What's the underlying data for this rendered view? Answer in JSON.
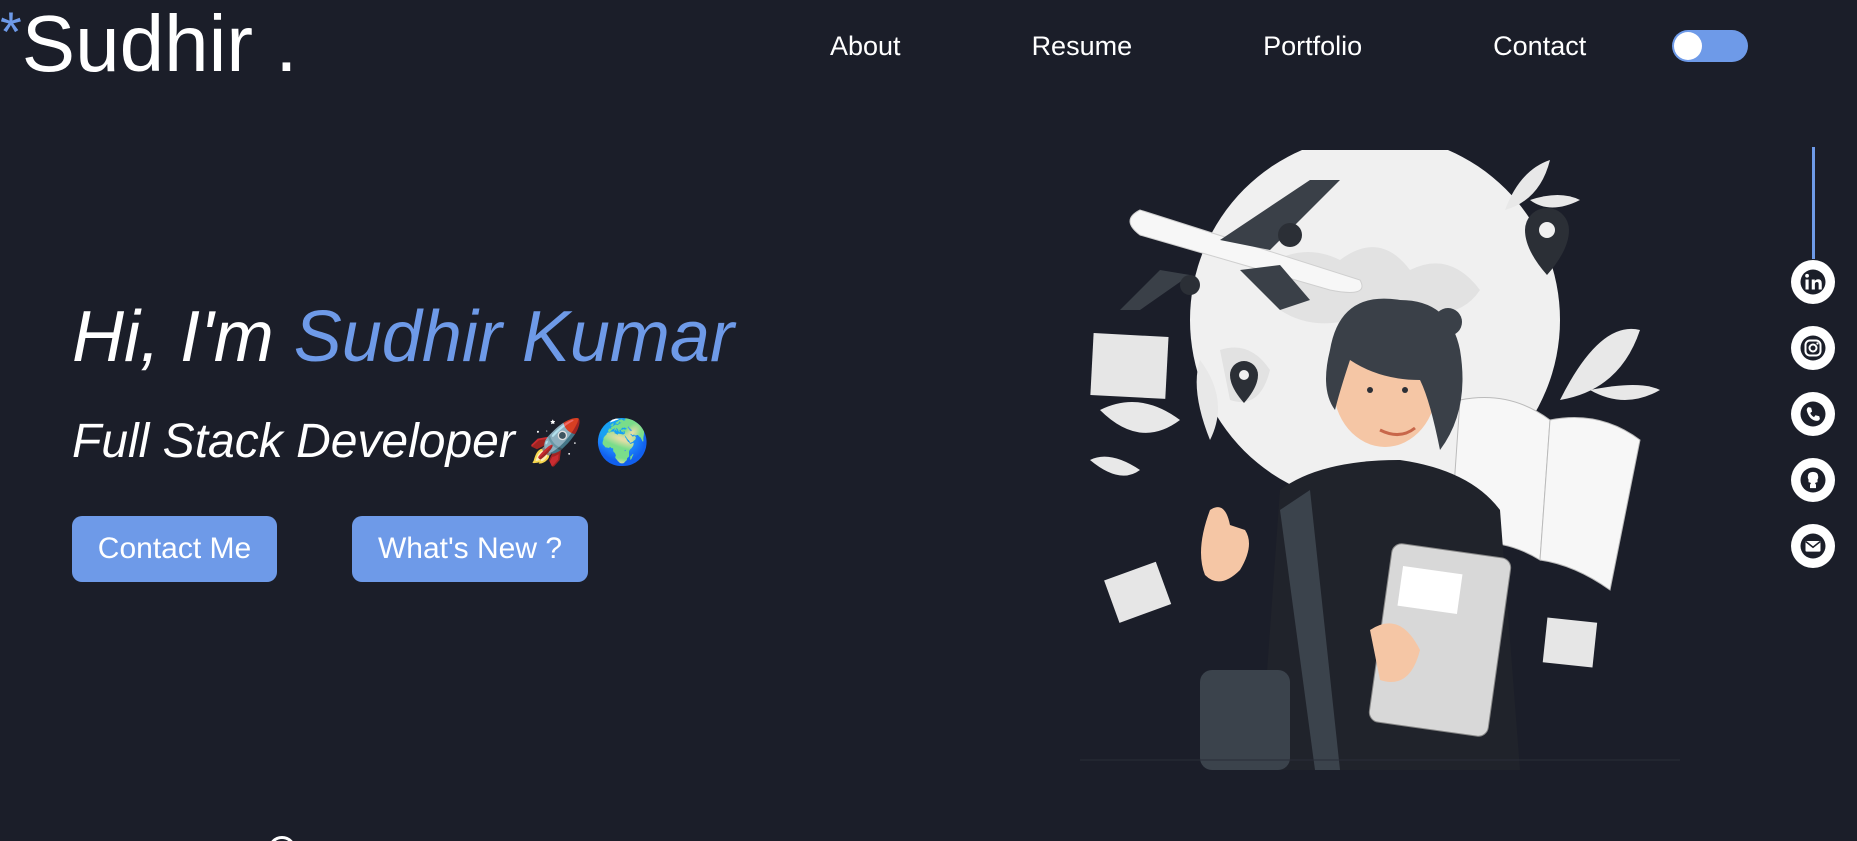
{
  "logo": {
    "star": "*",
    "name": "Sudhir ."
  },
  "nav": {
    "items": [
      {
        "label": "About"
      },
      {
        "label": "Resume"
      },
      {
        "label": "Portfolio"
      },
      {
        "label": "Contact"
      }
    ]
  },
  "theme_toggle": {
    "state": "on",
    "accent": "#6e9ae8"
  },
  "hero": {
    "greeting": "Hi, I'm ",
    "name": "Sudhir Kumar",
    "role": "Full Stack Developer ",
    "emojis": "🚀 🌍"
  },
  "buttons": {
    "contact": "Contact Me",
    "whats_new": "What's New ?"
  },
  "social": [
    {
      "icon": "linkedin-icon"
    },
    {
      "icon": "instagram-icon"
    },
    {
      "icon": "phone-icon"
    },
    {
      "icon": "github-icon"
    },
    {
      "icon": "mail-icon"
    }
  ],
  "colors": {
    "background": "#1b1e29",
    "accent": "#6e9ae8",
    "text": "#ffffff"
  }
}
